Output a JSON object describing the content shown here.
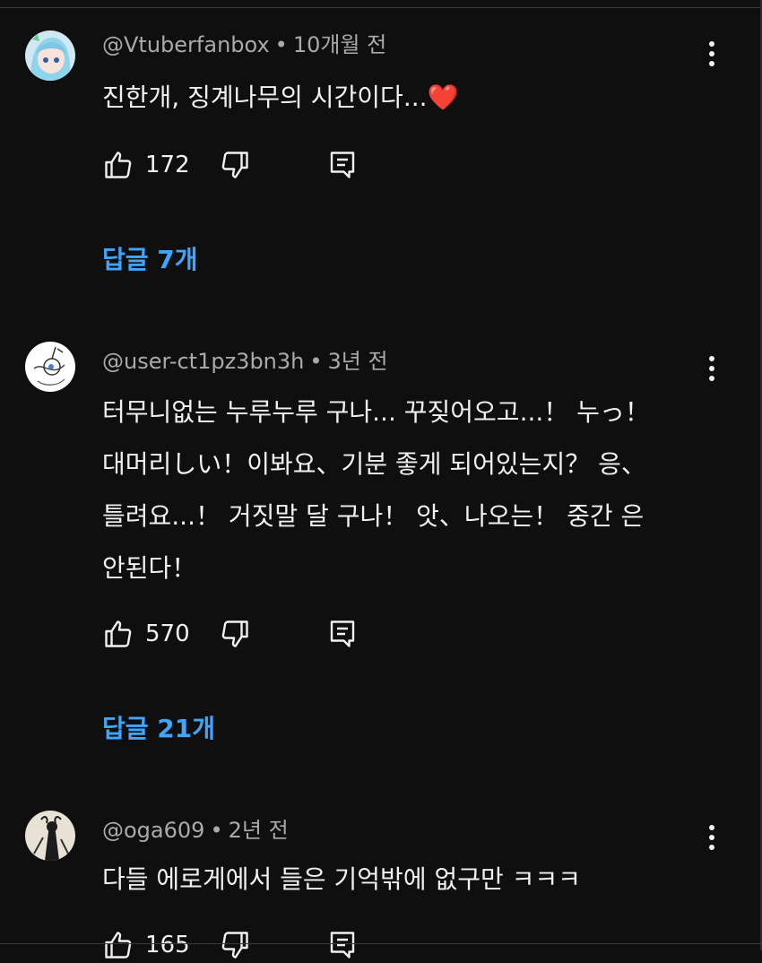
{
  "comments": [
    {
      "author": "@Vtuberfanbox",
      "separator": "•",
      "time": "10개월 전",
      "text": "진한개, 징계나무의 시간이다...",
      "emoji": "❤️",
      "likes": "172",
      "replies": "답글 7개"
    },
    {
      "author": "@user-ct1pz3bn3h",
      "separator": "•",
      "time": "3년 전",
      "text": "터무니없는 누루누루 구나... 꾸짖어오고...！ 누っ！\n대머리しい！이봐요、기분 좋게 되어있는지？ 응、\n틀려요...！ 거짓말 달 구나！ 앗、나오는！ 중간 은\n안된다！",
      "likes": "570",
      "replies": "답글 21개"
    },
    {
      "author": "@oga609",
      "separator": "•",
      "time": "2년 전",
      "text": "다들 에로게에서 들은 기억밖에 없구만 ㅋㅋㅋ",
      "likes": "165"
    }
  ],
  "icons": {
    "like": "thumbs-up-icon",
    "dislike": "thumbs-down-icon",
    "reply": "reply-icon",
    "more": "more-vert-icon"
  },
  "colors": {
    "background": "#0f0f0f",
    "text": "#f1f1f1",
    "meta": "#aaaaaa",
    "link": "#3ea6ff"
  }
}
